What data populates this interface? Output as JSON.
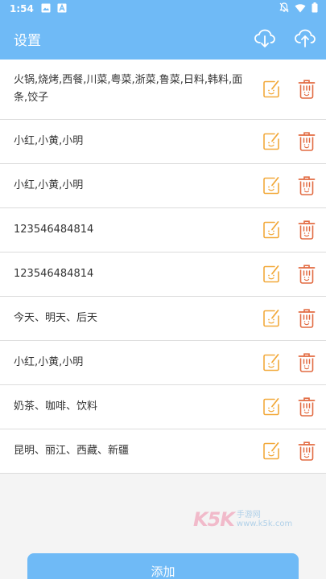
{
  "status_bar": {
    "time": "1:54",
    "left_icons": [
      "image-icon",
      "font-icon"
    ],
    "right_icons": [
      "mute-icon",
      "wifi-icon",
      "battery-icon"
    ]
  },
  "app_bar": {
    "title": "设置",
    "actions": [
      "cloud-download-icon",
      "cloud-upload-icon"
    ]
  },
  "rows": [
    {
      "text": "火锅,烧烤,西餐,川菜,粤菜,浙菜,鲁菜,日料,韩料,面条,饺子"
    },
    {
      "text": "小红,小黄,小明"
    },
    {
      "text": "小红,小黄,小明"
    },
    {
      "text": "123546484814"
    },
    {
      "text": "123546484814"
    },
    {
      "text": "今天、明天、后天"
    },
    {
      "text": "小红,小黄,小明"
    },
    {
      "text": "奶茶、咖啡、饮料"
    },
    {
      "text": "昆明、丽江、西藏、新疆"
    }
  ],
  "watermark": {
    "brand": "K5K",
    "line1": "手游网",
    "line2": "www.k5k.com"
  },
  "add_button_label": "添加",
  "colors": {
    "primary": "#6fbaf6",
    "edit_icon": "#f2a93b",
    "delete_icon": "#e26b42"
  }
}
